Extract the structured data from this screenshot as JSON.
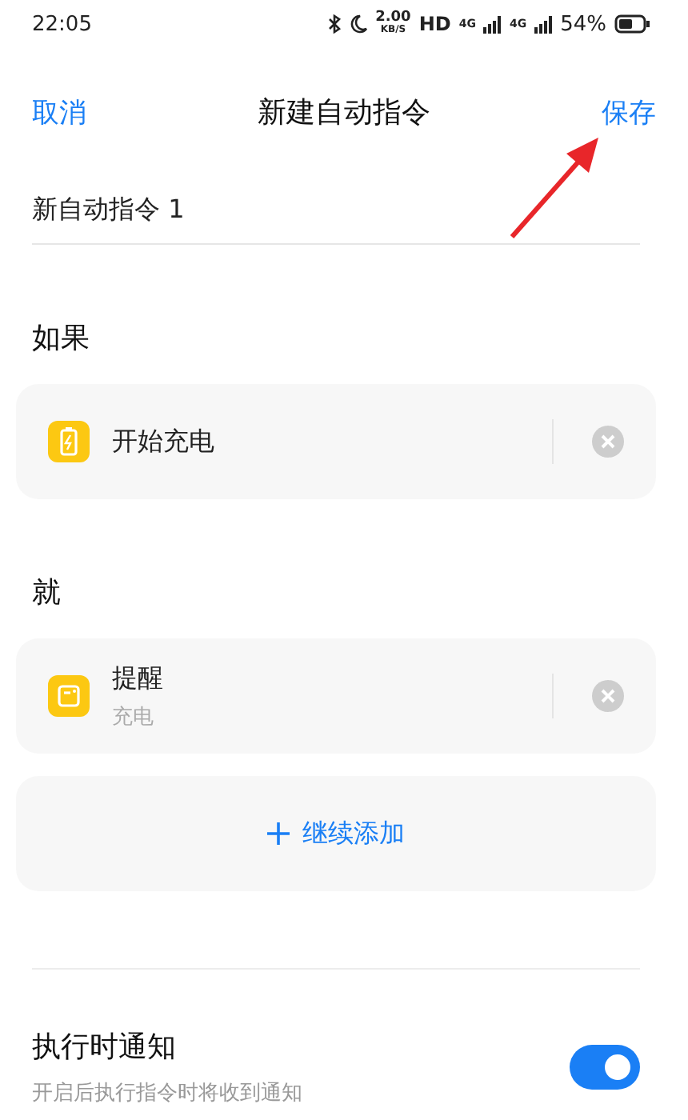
{
  "status_bar": {
    "time": "22:05",
    "net_speed": "2.00",
    "net_unit": "KB/S",
    "hd": "HD",
    "signal_1": "4G",
    "signal_2": "4G",
    "battery": "54%"
  },
  "header": {
    "cancel": "取消",
    "title": "新建自动指令",
    "save": "保存"
  },
  "name_field": {
    "value": "新自动指令 1"
  },
  "sections": [
    {
      "title": "如果",
      "items": [
        {
          "kind": "charging",
          "title": "开始充电"
        }
      ]
    },
    {
      "title": "就",
      "items": [
        {
          "kind": "reminder",
          "title": "提醒",
          "subtitle": "充电"
        }
      ]
    }
  ],
  "add_button": {
    "label": "继续添加"
  },
  "notify": {
    "title": "执行时通知",
    "subtitle": "开启后执行指令时将收到通知",
    "on": true
  }
}
